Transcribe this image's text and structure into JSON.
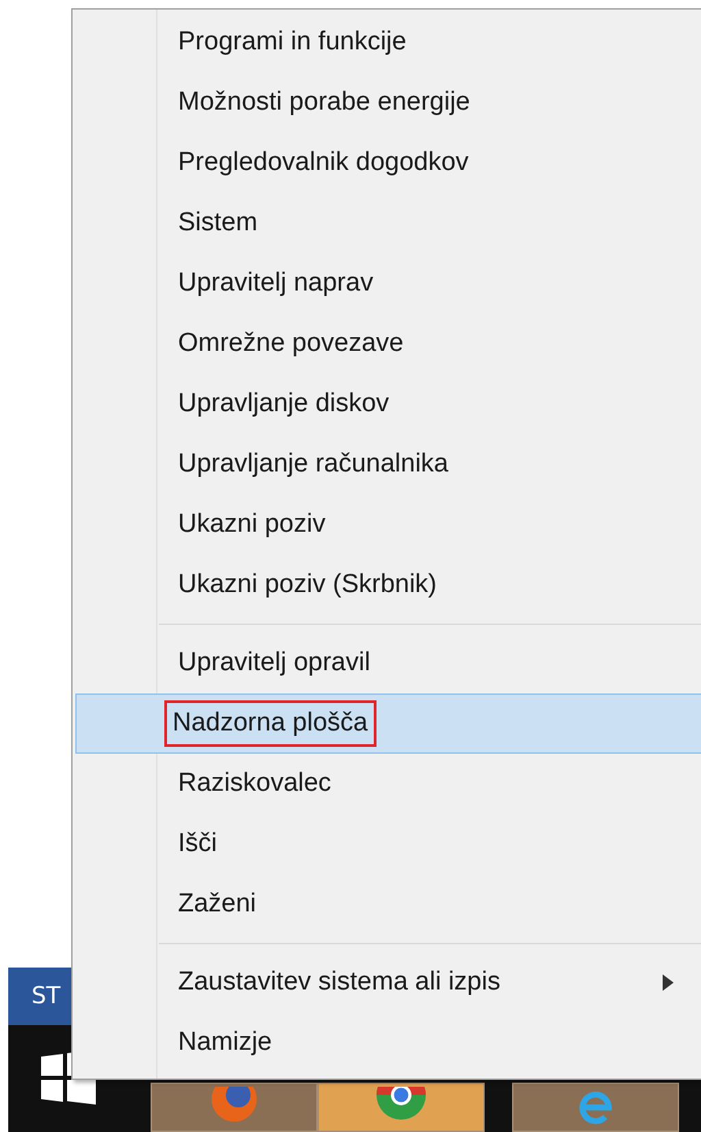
{
  "start_bar": {
    "label": "ST"
  },
  "menu": {
    "groups": [
      [
        {
          "label": "Programi in funkcije",
          "selected": false,
          "submenu": false
        },
        {
          "label": "Možnosti porabe energije",
          "selected": false,
          "submenu": false
        },
        {
          "label": "Pregledovalnik dogodkov",
          "selected": false,
          "submenu": false
        },
        {
          "label": "Sistem",
          "selected": false,
          "submenu": false
        },
        {
          "label": "Upravitelj naprav",
          "selected": false,
          "submenu": false
        },
        {
          "label": "Omrežne povezave",
          "selected": false,
          "submenu": false
        },
        {
          "label": "Upravljanje diskov",
          "selected": false,
          "submenu": false
        },
        {
          "label": "Upravljanje računalnika",
          "selected": false,
          "submenu": false
        },
        {
          "label": "Ukazni poziv",
          "selected": false,
          "submenu": false
        },
        {
          "label": "Ukazni poziv (Skrbnik)",
          "selected": false,
          "submenu": false
        }
      ],
      [
        {
          "label": "Upravitelj opravil",
          "selected": false,
          "submenu": false
        },
        {
          "label": "Nadzorna plošča",
          "selected": true,
          "submenu": false
        },
        {
          "label": "Raziskovalec",
          "selected": false,
          "submenu": false
        },
        {
          "label": "Išči",
          "selected": false,
          "submenu": false
        },
        {
          "label": "Zaženi",
          "selected": false,
          "submenu": false
        }
      ],
      [
        {
          "label": "Zaustavitev sistema ali izpis",
          "selected": false,
          "submenu": true
        },
        {
          "label": "Namizje",
          "selected": false,
          "submenu": false
        }
      ]
    ]
  }
}
